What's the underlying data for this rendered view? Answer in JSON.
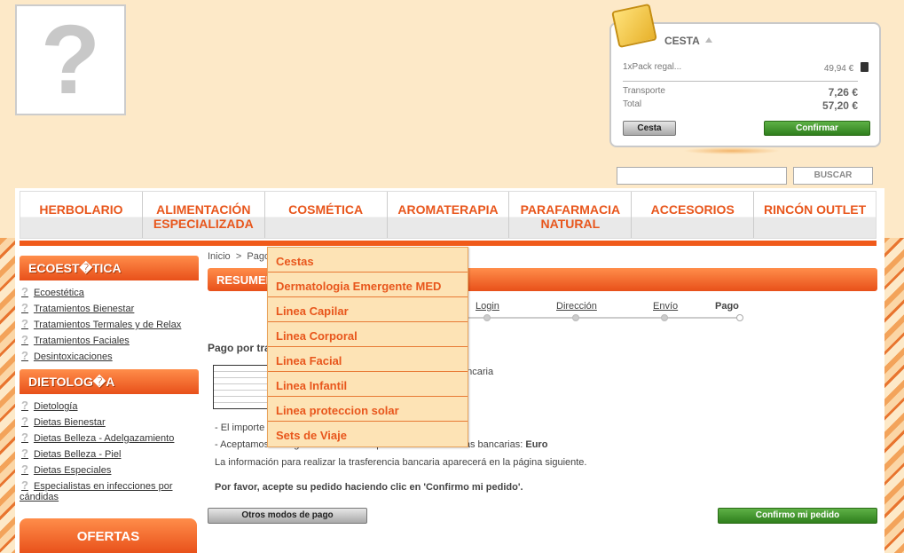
{
  "header": {
    "logo_placeholder": "?",
    "cart": {
      "title": "CESTA",
      "item": "1xPack regal...",
      "item_price": "49,94 €",
      "transport_label": "Transporte",
      "transport_value": "7,26 €",
      "total_label": "Total",
      "total_value": "57,20 €",
      "cart_button": "Cesta",
      "confirm_button": "Confirmar"
    },
    "search": {
      "placeholder": "",
      "button": "BUSCAR"
    }
  },
  "nav": {
    "items": [
      {
        "line1": "HERBOLARIO",
        "line2": ""
      },
      {
        "line1": "ALIMENTACIÓN",
        "line2": "ESPECIALIZADA"
      },
      {
        "line1": "COSMÉTICA",
        "line2": ""
      },
      {
        "line1": "AROMATERAPIA",
        "line2": ""
      },
      {
        "line1": "PARAFARMACIA",
        "line2": "NATURAL"
      },
      {
        "line1": "ACCESORIOS",
        "line2": ""
      },
      {
        "line1": "RINCÓN OUTLET",
        "line2": ""
      }
    ]
  },
  "dropdown": {
    "items": [
      "Cestas",
      "Dermatologia Emergente MED",
      "Linea Capilar",
      "Linea Corporal",
      "Linea Facial",
      "Linea Infantil",
      "Linea proteccion solar",
      "Sets de Viaje"
    ]
  },
  "sidebar": {
    "section1": {
      "title": "ECOEST�TICA",
      "links": [
        "Ecoestética",
        "Tratamientos Bienestar",
        "Tratamientos Termales y de Relax",
        "Tratamientos Faciales",
        "Desintoxicaciones"
      ]
    },
    "section2": {
      "title": "DIETOLOG�A",
      "links": [
        "Dietología",
        "Dietas Bienestar",
        "Dietas Belleza - Adelgazamiento",
        "Dietas Belleza - Piel",
        "Dietas Especiales"
      ],
      "last_link_line1": "Especialistas en infecciones por",
      "last_link_line2": "cándidas"
    },
    "ofertas": "OFERTAS"
  },
  "content": {
    "breadcrumb_home": "Inicio",
    "breadcrumb_sep": ">",
    "breadcrumb_current": "Pago",
    "section_title": "RESUMEN",
    "steps": [
      "Login",
      "Dirección",
      "Envío",
      "Pago"
    ],
    "pay_title": "Pago por tra",
    "pay_text": "ancaria",
    "info1": "- El importe t",
    "info2_prefix": "- Aceptamos las siguientes monedas para las transferencias bancarias: ",
    "info2_currency": "Euro",
    "info3": "La información para realizar la trasferencia bancaria aparecerá en la página siguiente.",
    "confirm_note": "Por favor, acepte su pedido haciendo clic en 'Confirmo mi pedido'.",
    "other_methods_button": "Otros modos de pago",
    "confirm_order_button": "Confirmo mi pedido"
  }
}
